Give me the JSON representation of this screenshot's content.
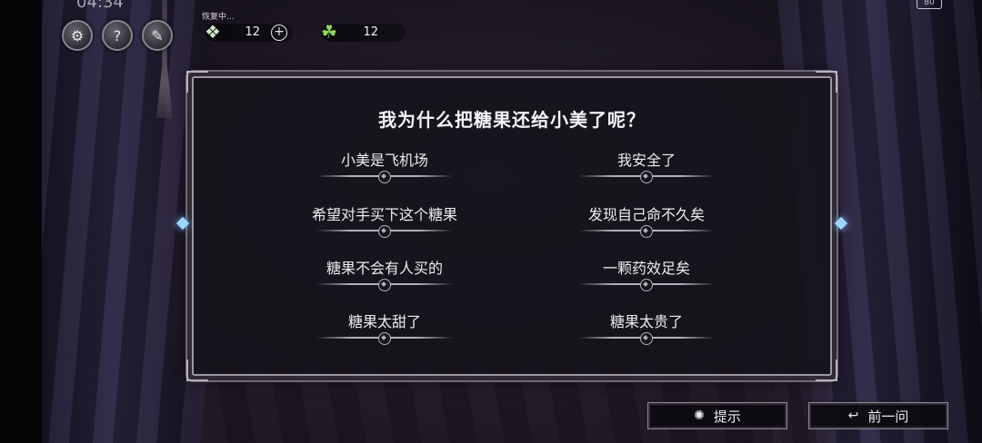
{
  "status": {
    "time": "04:34",
    "battery": "80"
  },
  "hud": {
    "buttons": [
      {
        "name": "settings",
        "icon": "gear-icon"
      },
      {
        "name": "help",
        "icon": "question-book-icon"
      },
      {
        "name": "notes",
        "icon": "notebook-pen-icon"
      }
    ],
    "restore_label": "恢复中...",
    "energy": {
      "value": "12",
      "icon": "energy-stack-icon"
    },
    "clover": {
      "value": "12",
      "icon": "clover-icon"
    }
  },
  "question": {
    "text": "我为什么把糖果还给小美了呢？"
  },
  "options": [
    {
      "text": "小美是飞机场"
    },
    {
      "text": "我安全了"
    },
    {
      "text": "希望对手买下这个糖果"
    },
    {
      "text": "发现自己命不久矣"
    },
    {
      "text": "糖果不会有人买的"
    },
    {
      "text": "一颗药效足矣"
    },
    {
      "text": "糖果太甜了"
    },
    {
      "text": "糖果太贵了"
    }
  ],
  "footer": {
    "hint_label": "提示",
    "back_label": "前一问"
  },
  "colors": {
    "panel_border": "#9d98a3",
    "text": "#f4f2f6",
    "gem": "#9fd4ff"
  }
}
